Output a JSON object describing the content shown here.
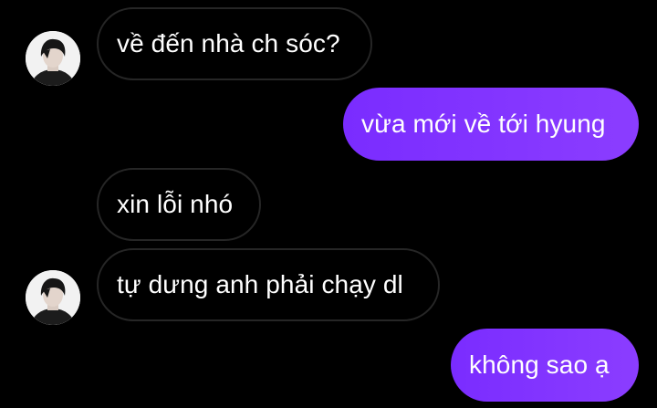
{
  "theme": {
    "background": "#000000",
    "incoming_border": "#262626",
    "outgoing_gradient_start": "#7a2cff",
    "outgoing_gradient_end": "#8b3dff",
    "text": "#ffffff"
  },
  "conversation": {
    "messages": [
      {
        "direction": "incoming",
        "text": "về đến nhà ch sóc?",
        "avatar": "contact-avatar-photo"
      },
      {
        "direction": "outgoing",
        "text": "vừa mới về tới hyung"
      },
      {
        "direction": "incoming",
        "text": "xin lỗi nhó"
      },
      {
        "direction": "incoming",
        "text": "tự dưng anh phải chạy dl",
        "avatar": "contact-avatar-photo"
      },
      {
        "direction": "outgoing",
        "text": "không sao ạ"
      }
    ]
  }
}
